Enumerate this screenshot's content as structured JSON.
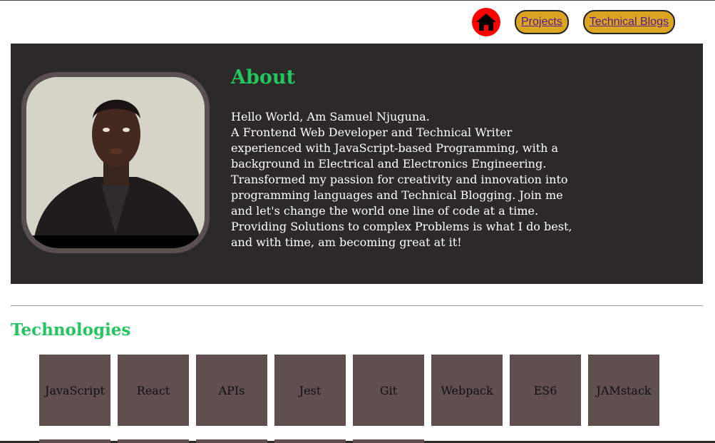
{
  "nav": {
    "home_icon": "home-icon",
    "projects_label": "Projects",
    "blogs_label": "Technical Blogs",
    "colors": {
      "home_bg": "#ff0000",
      "pill_bg": "#daa520",
      "link": "#551a8b"
    }
  },
  "about": {
    "title": "About",
    "lines": [
      "Hello World, Am Samuel Njuguna.",
      "A Frontend Web Developer and Technical Writer",
      "experienced with JavaScript-based Programming, with a",
      "background in Electrical and Electronics Engineering.",
      "Transformed my passion for creativity and innovation into",
      "programming languages and Technical Blogging. Join me",
      "and let's change the world one line of code at a time.",
      "Providing Solutions to complex Problems is what I do best,",
      "and with time, am becoming great at it!"
    ],
    "colors": {
      "panel_bg": "#2b2a28",
      "title": "#22c55e",
      "text": "#ffffff"
    }
  },
  "technologies": {
    "title": "Technologies",
    "items": [
      "JavaScript",
      "React",
      "APIs",
      "Jest",
      "Git",
      "Webpack",
      "ES6",
      "JAMstack"
    ],
    "colors": {
      "card_bg": "#5f4f4f",
      "title": "#22c55e"
    }
  }
}
